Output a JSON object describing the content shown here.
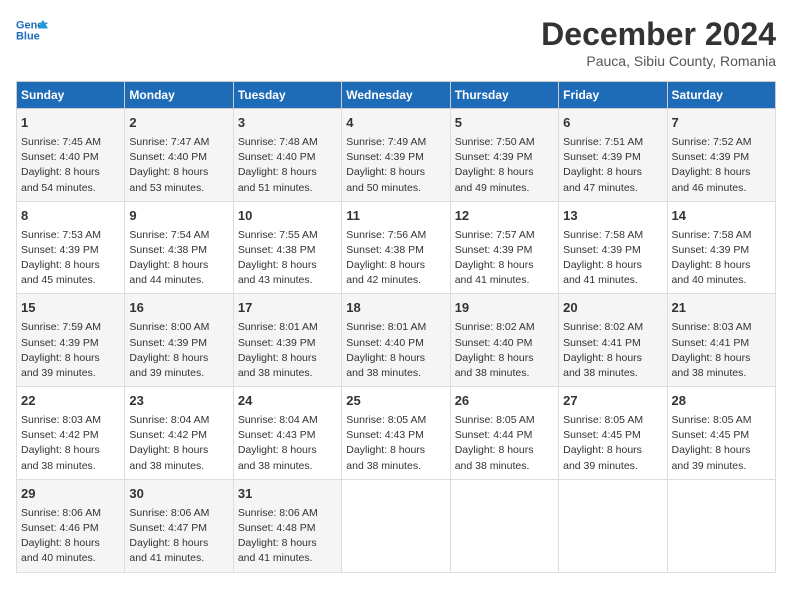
{
  "header": {
    "logo_line1": "General",
    "logo_line2": "Blue",
    "month": "December 2024",
    "location": "Pauca, Sibiu County, Romania"
  },
  "weekdays": [
    "Sunday",
    "Monday",
    "Tuesday",
    "Wednesday",
    "Thursday",
    "Friday",
    "Saturday"
  ],
  "weeks": [
    [
      {
        "day": "1",
        "info": "Sunrise: 7:45 AM\nSunset: 4:40 PM\nDaylight: 8 hours\nand 54 minutes."
      },
      {
        "day": "2",
        "info": "Sunrise: 7:47 AM\nSunset: 4:40 PM\nDaylight: 8 hours\nand 53 minutes."
      },
      {
        "day": "3",
        "info": "Sunrise: 7:48 AM\nSunset: 4:40 PM\nDaylight: 8 hours\nand 51 minutes."
      },
      {
        "day": "4",
        "info": "Sunrise: 7:49 AM\nSunset: 4:39 PM\nDaylight: 8 hours\nand 50 minutes."
      },
      {
        "day": "5",
        "info": "Sunrise: 7:50 AM\nSunset: 4:39 PM\nDaylight: 8 hours\nand 49 minutes."
      },
      {
        "day": "6",
        "info": "Sunrise: 7:51 AM\nSunset: 4:39 PM\nDaylight: 8 hours\nand 47 minutes."
      },
      {
        "day": "7",
        "info": "Sunrise: 7:52 AM\nSunset: 4:39 PM\nDaylight: 8 hours\nand 46 minutes."
      }
    ],
    [
      {
        "day": "8",
        "info": "Sunrise: 7:53 AM\nSunset: 4:39 PM\nDaylight: 8 hours\nand 45 minutes."
      },
      {
        "day": "9",
        "info": "Sunrise: 7:54 AM\nSunset: 4:38 PM\nDaylight: 8 hours\nand 44 minutes."
      },
      {
        "day": "10",
        "info": "Sunrise: 7:55 AM\nSunset: 4:38 PM\nDaylight: 8 hours\nand 43 minutes."
      },
      {
        "day": "11",
        "info": "Sunrise: 7:56 AM\nSunset: 4:38 PM\nDaylight: 8 hours\nand 42 minutes."
      },
      {
        "day": "12",
        "info": "Sunrise: 7:57 AM\nSunset: 4:39 PM\nDaylight: 8 hours\nand 41 minutes."
      },
      {
        "day": "13",
        "info": "Sunrise: 7:58 AM\nSunset: 4:39 PM\nDaylight: 8 hours\nand 41 minutes."
      },
      {
        "day": "14",
        "info": "Sunrise: 7:58 AM\nSunset: 4:39 PM\nDaylight: 8 hours\nand 40 minutes."
      }
    ],
    [
      {
        "day": "15",
        "info": "Sunrise: 7:59 AM\nSunset: 4:39 PM\nDaylight: 8 hours\nand 39 minutes."
      },
      {
        "day": "16",
        "info": "Sunrise: 8:00 AM\nSunset: 4:39 PM\nDaylight: 8 hours\nand 39 minutes."
      },
      {
        "day": "17",
        "info": "Sunrise: 8:01 AM\nSunset: 4:39 PM\nDaylight: 8 hours\nand 38 minutes."
      },
      {
        "day": "18",
        "info": "Sunrise: 8:01 AM\nSunset: 4:40 PM\nDaylight: 8 hours\nand 38 minutes."
      },
      {
        "day": "19",
        "info": "Sunrise: 8:02 AM\nSunset: 4:40 PM\nDaylight: 8 hours\nand 38 minutes."
      },
      {
        "day": "20",
        "info": "Sunrise: 8:02 AM\nSunset: 4:41 PM\nDaylight: 8 hours\nand 38 minutes."
      },
      {
        "day": "21",
        "info": "Sunrise: 8:03 AM\nSunset: 4:41 PM\nDaylight: 8 hours\nand 38 minutes."
      }
    ],
    [
      {
        "day": "22",
        "info": "Sunrise: 8:03 AM\nSunset: 4:42 PM\nDaylight: 8 hours\nand 38 minutes."
      },
      {
        "day": "23",
        "info": "Sunrise: 8:04 AM\nSunset: 4:42 PM\nDaylight: 8 hours\nand 38 minutes."
      },
      {
        "day": "24",
        "info": "Sunrise: 8:04 AM\nSunset: 4:43 PM\nDaylight: 8 hours\nand 38 minutes."
      },
      {
        "day": "25",
        "info": "Sunrise: 8:05 AM\nSunset: 4:43 PM\nDaylight: 8 hours\nand 38 minutes."
      },
      {
        "day": "26",
        "info": "Sunrise: 8:05 AM\nSunset: 4:44 PM\nDaylight: 8 hours\nand 38 minutes."
      },
      {
        "day": "27",
        "info": "Sunrise: 8:05 AM\nSunset: 4:45 PM\nDaylight: 8 hours\nand 39 minutes."
      },
      {
        "day": "28",
        "info": "Sunrise: 8:05 AM\nSunset: 4:45 PM\nDaylight: 8 hours\nand 39 minutes."
      }
    ],
    [
      {
        "day": "29",
        "info": "Sunrise: 8:06 AM\nSunset: 4:46 PM\nDaylight: 8 hours\nand 40 minutes."
      },
      {
        "day": "30",
        "info": "Sunrise: 8:06 AM\nSunset: 4:47 PM\nDaylight: 8 hours\nand 41 minutes."
      },
      {
        "day": "31",
        "info": "Sunrise: 8:06 AM\nSunset: 4:48 PM\nDaylight: 8 hours\nand 41 minutes."
      },
      null,
      null,
      null,
      null
    ]
  ]
}
